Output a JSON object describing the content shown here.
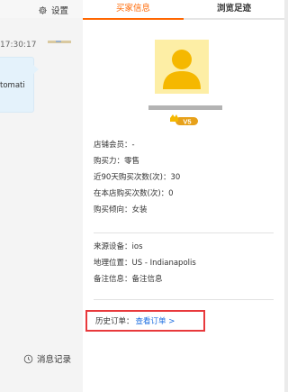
{
  "left_panel": {
    "settings_label": "设置",
    "settings_icon": "gear-icon",
    "chat_time": "17:30:17",
    "bubble_text": "tomati",
    "history_label": "消息记录",
    "history_icon": "clock-icon"
  },
  "tabs": [
    {
      "label": "买家信息",
      "active": true
    },
    {
      "label": "浏览足迹",
      "active": false
    }
  ],
  "profile": {
    "avatar_icon": "user-avatar-icon",
    "level_badge": "V5"
  },
  "info": {
    "shop_member": "店铺会员：-",
    "purchasing_power_label": "购买力：",
    "purchasing_power_value": "零售",
    "recent90_label": "近90天购买次数(次)：",
    "recent90_value": "30",
    "store_purchases_label": "在本店购买次数(次)：",
    "store_purchases_value": "0",
    "tendency_label": "购买倾向：",
    "tendency_value": "女装"
  },
  "device": {
    "source_label": "来源设备：",
    "source_value": "ios",
    "location_label": "地理位置：",
    "location_value": "US - Indianapolis",
    "note_label": "备注信息：",
    "note_value": "备注信息"
  },
  "orders": {
    "label": "历史订单：",
    "link": "查看订单 >"
  },
  "colors": {
    "accent": "#ff6600",
    "link": "#1a6ce0",
    "highlight_border": "#e8393c",
    "avatar_bg": "#fdeea5",
    "avatar_fg": "#f5b800"
  }
}
